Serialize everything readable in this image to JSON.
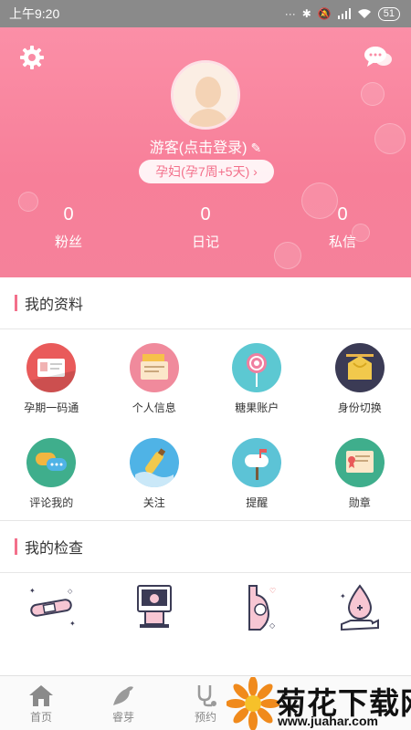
{
  "status_bar": {
    "time": "上午9:20",
    "dots": "···",
    "battery": "51"
  },
  "profile": {
    "username": "游客(点击登录)",
    "pregnancy_badge": "孕妇(孕7周+5天) ›",
    "stats": [
      {
        "value": "0",
        "label": "粉丝"
      },
      {
        "value": "0",
        "label": "日记"
      },
      {
        "value": "0",
        "label": "私信"
      }
    ]
  },
  "my_profile": {
    "title": "我的资料",
    "items": [
      {
        "label": "孕期一码通",
        "icon": "id-card-icon",
        "color": "#e95a5a"
      },
      {
        "label": "个人信息",
        "icon": "profile-folder-icon",
        "color": "#f08a9c"
      },
      {
        "label": "糖果账户",
        "icon": "lollipop-icon",
        "color": "#5cc8d2"
      },
      {
        "label": "身份切换",
        "icon": "switch-identity-icon",
        "color": "#f2b640"
      },
      {
        "label": "评论我的",
        "icon": "comment-icon",
        "color": "#3fae8c"
      },
      {
        "label": "关注",
        "icon": "bottle-icon",
        "color": "#4fb3e6"
      },
      {
        "label": "提醒",
        "icon": "mailbox-icon",
        "color": "#5cc3d6"
      },
      {
        "label": "勋章",
        "icon": "certificate-icon",
        "color": "#3fae8c"
      }
    ]
  },
  "my_exams": {
    "title": "我的检查",
    "items": [
      {
        "icon": "pregnancy-test-icon"
      },
      {
        "icon": "ultrasound-icon"
      },
      {
        "icon": "pregnant-belly-icon"
      },
      {
        "icon": "blood-drop-hand-icon"
      }
    ]
  },
  "bottom_nav": {
    "items": [
      {
        "label": "首页",
        "icon": "home-icon"
      },
      {
        "label": "睿芽",
        "icon": "bird-icon"
      },
      {
        "label": "预约",
        "icon": "stethoscope-icon"
      }
    ]
  },
  "watermark": {
    "brand": "菊花下载网",
    "url": "www.juahar.com"
  }
}
